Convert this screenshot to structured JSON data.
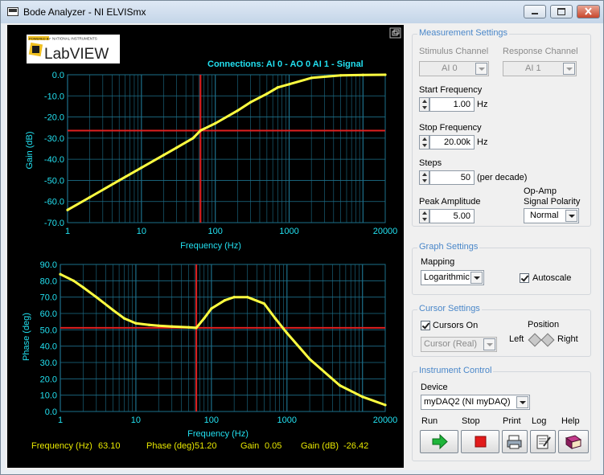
{
  "window": {
    "title": "Bode Analyzer - NI ELVISmx"
  },
  "logo": {
    "powered_by": "POWERED BY",
    "vendor": "NATIONAL INSTRUMENTS",
    "product": "LabVIEW"
  },
  "connections": "Connections: AI 0 - AO 0   AI 1 - Signal",
  "colors": {
    "plot_bg": "#000000",
    "grid": "#1d6f8a",
    "axis_text": "#22e0f0",
    "trace": "#ffff40",
    "cursor": "#e02020",
    "readout": "#e8e800",
    "group_title": "#4a87c9"
  },
  "gain_plot": {
    "ylabel": "Gain (dB)",
    "xlabel": "Frequency (Hz)",
    "yticks": [
      "0.0",
      "-10.0",
      "-20.0",
      "-30.0",
      "-40.0",
      "-50.0",
      "-60.0",
      "-70.0"
    ],
    "xticks": [
      "1",
      "10",
      "100",
      "1000",
      "20000"
    ]
  },
  "phase_plot": {
    "ylabel": "Phase (deg)",
    "xlabel": "Frequency (Hz)",
    "yticks": [
      "90.0",
      "80.0",
      "70.0",
      "60.0",
      "50.0",
      "40.0",
      "30.0",
      "20.0",
      "10.0",
      "0.0"
    ],
    "xticks": [
      "1",
      "10",
      "100",
      "1000",
      "20000"
    ]
  },
  "chart_data": [
    {
      "type": "line",
      "ylabel": "Gain (dB)",
      "xlabel": "Frequency (Hz)",
      "xscale": "log",
      "xlim": [
        1,
        20000
      ],
      "ylim": [
        -70,
        0
      ],
      "grid": true,
      "series": [
        {
          "x": [
            1,
            2,
            5,
            10,
            20,
            30,
            50,
            63.1,
            100,
            200,
            300,
            500,
            700,
            1000,
            2000,
            5000,
            10000,
            20000
          ],
          "y": [
            -64.0,
            -58.0,
            -50.0,
            -44.0,
            -38.0,
            -34.5,
            -30.0,
            -26.4,
            -23.0,
            -17.0,
            -13.0,
            -9.0,
            -6.0,
            -4.5,
            -1.5,
            -0.3,
            -0.1,
            0.0
          ]
        }
      ],
      "cursor": {
        "x": 63.1,
        "y": -26.42
      }
    },
    {
      "type": "line",
      "ylabel": "Phase (deg)",
      "xlabel": "Frequency (Hz)",
      "xscale": "log",
      "xlim": [
        1,
        20000
      ],
      "ylim": [
        0,
        90
      ],
      "grid": true,
      "series": [
        {
          "x": [
            1,
            1.5,
            2,
            3,
            5,
            7,
            10,
            15,
            20,
            30,
            50,
            63.1,
            80,
            100,
            150,
            200,
            300,
            500,
            700,
            1000,
            2000,
            5000,
            10000,
            20000
          ],
          "y": [
            84,
            80,
            76,
            70,
            62,
            57,
            54,
            53,
            52.5,
            52,
            51.5,
            51.2,
            57,
            63,
            68,
            70,
            70,
            66,
            57,
            48,
            32,
            16,
            9,
            4
          ]
        }
      ],
      "cursor": {
        "x": 63.1,
        "y": 51.2
      }
    }
  ],
  "readout": {
    "freq_label": "Frequency (Hz)",
    "freq_value": "63.10",
    "phase_label": "Phase (deg)",
    "phase_value": "51.20",
    "gain_label": "Gain",
    "gain_value": "0.05",
    "gaindb_label": "Gain (dB)",
    "gaindb_value": "-26.42"
  },
  "measurement": {
    "title": "Measurement Settings",
    "stimulus_label": "Stimulus Channel",
    "stimulus_value": "AI 0",
    "response_label": "Response Channel",
    "response_value": "AI 1",
    "start_label": "Start Frequency",
    "start_value": "1.00",
    "start_unit": "Hz",
    "stop_label": "Stop Frequency",
    "stop_value": "20.00k",
    "stop_unit": "Hz",
    "steps_label": "Steps",
    "steps_value": "50",
    "steps_unit": "(per decade)",
    "peak_label": "Peak Amplitude",
    "peak_value": "5.00",
    "polarity_label1": "Op-Amp",
    "polarity_label2": "Signal Polarity",
    "polarity_value": "Normal"
  },
  "graph_settings": {
    "title": "Graph Settings",
    "mapping_label": "Mapping",
    "mapping_value": "Logarithmic",
    "autoscale_label": "Autoscale"
  },
  "cursor_settings": {
    "title": "Cursor Settings",
    "cursors_on_label": "Cursors On",
    "cursor_mode": "Cursor (Real)",
    "position_label": "Position",
    "left_label": "Left",
    "right_label": "Right"
  },
  "instrument": {
    "title": "Instrument Control",
    "device_label": "Device",
    "device_value": "myDAQ2 (NI myDAQ)"
  },
  "toolbar": {
    "run_label": "Run",
    "stop_label": "Stop",
    "print_label": "Print",
    "log_label": "Log",
    "help_label": "Help"
  }
}
